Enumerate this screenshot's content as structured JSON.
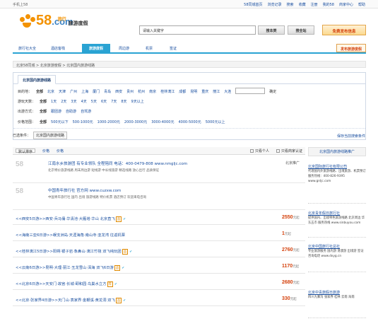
{
  "topbar": {
    "left": "手机上58",
    "links": [
      "58同城首页",
      "浏览记录",
      "搜索",
      "收藏",
      "注册",
      "我的58",
      "商家中心",
      "帮助"
    ]
  },
  "logo": {
    "brand": "58.com",
    "brand_num": "58",
    "brand_dom": ".com",
    "sub": "旅行",
    "tagline": "旅游度假"
  },
  "search": {
    "value": "请输入关键字",
    "btn_site": "搜本类",
    "btn_all": "搜全站",
    "post": "免费发布信息"
  },
  "nav": {
    "items": [
      "旅行社大全",
      "酒店客栈",
      "旅游度假",
      "周边游",
      "机票",
      "签证"
    ],
    "publish": "发布旅游度假"
  },
  "breadcrumb": "北京58同城 > 北京旅游度假 > 北京国内旅游线路",
  "filter": {
    "tab": "北京国内旅游线路",
    "dest": {
      "label": "目的地：",
      "all": "全部",
      "opts": [
        "北京",
        "天津",
        "广州",
        "上海",
        "厦门",
        "青岛",
        "西安",
        "贵州",
        "杭州",
        "南京",
        "桂林漓江",
        "成都",
        "昆明",
        "重庆",
        "丽江",
        "大连"
      ],
      "go": "确定"
    },
    "days": {
      "label": "游玩天数：",
      "all": "全部",
      "opts": [
        "1天",
        "2天",
        "3天",
        "4天",
        "5天",
        "6天",
        "7天",
        "8天",
        "9天以上"
      ]
    },
    "type": {
      "label": "出游方式：",
      "all": "全部",
      "opts": [
        "跟团游",
        "自助游",
        "自驾游"
      ]
    },
    "price": {
      "label": "价格范围：",
      "all": "全部",
      "opts": [
        "500元以下",
        "500-1000元",
        "1000-2000元",
        "2000-3000元",
        "3000-4000元",
        "4000-5000元",
        "5000元以上"
      ]
    },
    "chosen_label": "已选条件：",
    "chosen_tag": "北京国内旅游线路"
  },
  "save_tip": "保存当前搜索条件",
  "sortbar": {
    "sort": "默认排序",
    "price": "价格",
    "price2": "价格",
    "personal": "只看个人",
    "cert": "只看商家认证"
  },
  "ads": [
    {
      "title": "江南水乡旅游团 有专业领队 全程陪同  电话：400-0479-808  www.nmgljc.com",
      "desc": "北京特价旅游线路 周末周边游 短线游 中长线旅游 精选线路 放心出行 品质保证",
      "tag": "北京推广"
    },
    {
      "title": "中国青年旅行社 官方网 www.cuzxw.com",
      "desc": "中国青年旅行社 国内 出境 旅游线路 特价机票 酒店预订 欢迎来电咨询",
      "tag": ""
    }
  ],
  "rows": [
    {
      "title": "<<西安5日游>>西安·兵马俑·华清池·大雁塔·华山 北京直飞",
      "price": "2550",
      "unit": "元起",
      "mark": "品"
    },
    {
      "title": "<<海南三亚6日游>>蜈支洲岛·天涯海角·南山寺·亚龙湾 往返机票",
      "price": "1",
      "unit": "元起",
      "mark": ""
    },
    {
      "title": "<<桂林漓江5日游>>阳朔·银子岩·象鼻山·漓江竹筏 双飞纯玩团",
      "price": "2760",
      "unit": "元起",
      "mark": "品"
    },
    {
      "title": "<<云南6日游>>昆明·大理·丽江·玉龙雪山·洱海 双飞6日游",
      "price": "1170",
      "unit": "元起",
      "mark": "品"
    },
    {
      "title": "<<北京6日游>>天安门·故宫·长城·颐和园·鸟巢水立方",
      "price": "2680",
      "unit": "元起",
      "mark": "荐"
    },
    {
      "title": "<<北京·张家界4日游>>天门山·袁家界·金鞭溪·黄龙洞 双飞",
      "price": "330",
      "unit": "元起",
      "mark": "品"
    }
  ],
  "side": {
    "hd": "北京国内旅游线路推广",
    "ads": [
      {
        "title": "北京国际旅行社有限公司",
        "desc": "代理国内外旅游线路、出境旅游、机票预订 服务热线：400-826-9395 www.gnljc.com"
      },
      {
        "title": "北京青年假日旅行社",
        "desc": "提供国内、出境特色旅游线路 北京周边 华东五市 服务热线 www.sinbuyou.com"
      },
      {
        "title": "北京中国旅行社总社",
        "desc": "专业旅游服务 国内游 港澳游 出境游 签证 咨询电话 www.dxyg.cn"
      },
      {
        "title": "北京中青旅假日旅游",
        "desc": "四川九寨沟 张家界 桂林 云南 海南"
      }
    ]
  }
}
